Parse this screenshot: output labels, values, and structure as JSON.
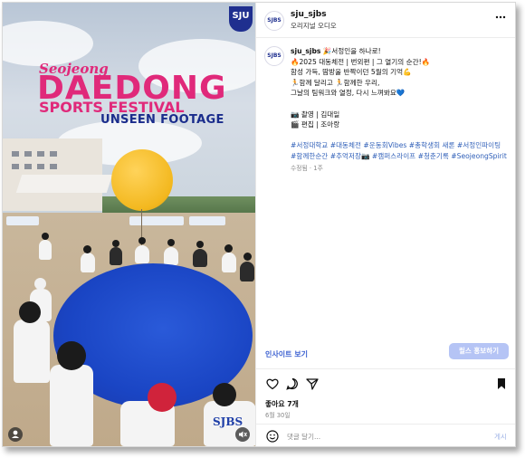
{
  "media": {
    "title_top": "Seojeong",
    "title_main": "DAEDONG",
    "title_sports": "SPORTS FESTIVAL",
    "title_unseen": "UNSEEN FOOTAGE",
    "logo_text": "SJU",
    "watermark": "SJBS"
  },
  "header": {
    "avatar_text": "SJBS",
    "username": "sju_sjbs",
    "audio": "오리지널 오디오",
    "more": "⋮"
  },
  "caption": {
    "avatar_text": "SJBS",
    "username": "sju_sjbs",
    "lines": [
      "🎉서정인을 하나로!",
      "🔥2025 대동체전 | 번외편 | 그 열기의 순간!🔥",
      "함성 가득, 땀방울 반짝이던 5월의 기억💪",
      "🏃함께 달리고 🏃함께한 우리,",
      "그날의 팀워크와 열정, 다시 느껴봐요💙"
    ],
    "credits": [
      "📷 촬영 | 김대일",
      "🎬 편집 | 조아랑"
    ],
    "hashtags": "#서정대학교 #대동체전 #운동회Vibes #총학생회 새론 #서정인파이팅 #함께한순간 #추억저장📷 #캠퍼스라이프 #청춘기록 #SeojeongSpirit",
    "meta": "수정됨 · 1주"
  },
  "insight_label": "인사이트 보기",
  "boost_label": "릴스 홍보하기",
  "likes": "좋아요 7개",
  "date": "6월 30일",
  "comment": {
    "placeholder": "댓글 달기...",
    "post_label": "게시"
  },
  "colors": {
    "accent_pink": "#e0297a",
    "accent_navy": "#1a2c8c",
    "link_blue": "#2f5fb8",
    "boost_bg": "#b5c4f5"
  }
}
